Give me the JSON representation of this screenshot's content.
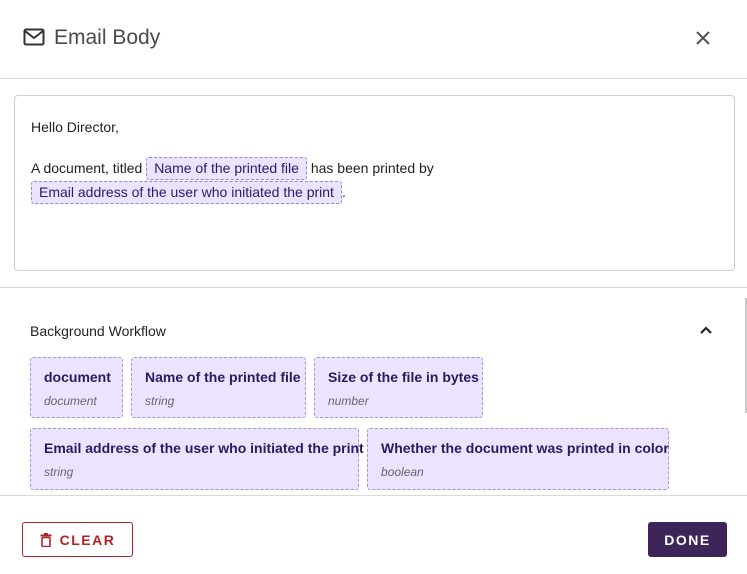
{
  "header": {
    "title": "Email Body",
    "icon": "mail-icon",
    "close_icon": "close-icon"
  },
  "editor": {
    "greeting": "Hello Director,",
    "line_prefix": "A document, titled",
    "chip_file_name": "Name of the printed file",
    "line_middle": "has been printed by",
    "chip_user_email": "Email address of the user who initiated the print",
    "line_suffix": "."
  },
  "workflow": {
    "title": "Background Workflow",
    "collapse_icon": "chevron-up-icon",
    "variables": [
      {
        "name": "document",
        "type": "document"
      },
      {
        "name": "Name of the printed file",
        "type": "string"
      },
      {
        "name": "Size of the file in bytes",
        "type": "number"
      },
      {
        "name": "Email address of the user who initiated the print",
        "type": "string"
      },
      {
        "name": "Whether the document was printed in color",
        "type": "boolean"
      }
    ]
  },
  "footer": {
    "clear_label": "CLEAR",
    "done_label": "DONE",
    "clear_icon": "trash-icon"
  },
  "colors": {
    "chip_bg": "#ebe3ff",
    "chip_border": "#a895d9",
    "danger": "#b02525",
    "primary": "#3d2559"
  }
}
